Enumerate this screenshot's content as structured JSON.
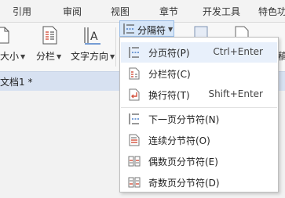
{
  "menubar": {
    "tabs": [
      "引用",
      "审阅",
      "视图",
      "章节",
      "开发工具",
      "特色功"
    ]
  },
  "ribbon": {
    "size_label": "大小",
    "columns_label": "分栏",
    "text_direction_label": "文字方向",
    "separator_label": "分隔符",
    "right_partial_label": "稿"
  },
  "document": {
    "tab_title": "文档1 *"
  },
  "dropdown": {
    "items": [
      {
        "label": "分页符(P)",
        "shortcut": "Ctrl+Enter",
        "icon": "page-break-icon"
      },
      {
        "label": "分栏符(C)",
        "shortcut": "",
        "icon": "column-break-icon"
      },
      {
        "label": "换行符(T)",
        "shortcut": "Shift+Enter",
        "icon": "line-break-icon"
      },
      {
        "label": "下一页分节符(N)",
        "shortcut": "",
        "icon": "next-page-section-break-icon"
      },
      {
        "label": "连续分节符(O)",
        "shortcut": "",
        "icon": "continuous-section-break-icon"
      },
      {
        "label": "偶数页分节符(E)",
        "shortcut": "",
        "icon": "even-page-section-break-icon"
      },
      {
        "label": "奇数页分节符(D)",
        "shortcut": "",
        "icon": "odd-page-section-break-icon"
      }
    ]
  },
  "colors": {
    "accent_blue": "#4a7fc8",
    "icon_red": "#d4503c",
    "highlight": "#e8f0fb",
    "doc_tab_bar": "#d7e1f1"
  }
}
